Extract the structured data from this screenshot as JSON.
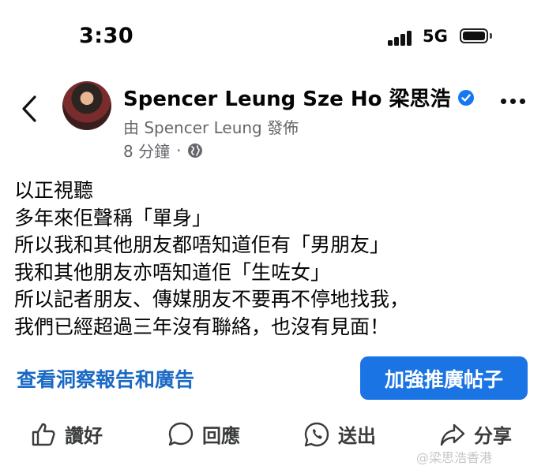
{
  "status_bar": {
    "time": "3:30",
    "network": "5G",
    "signal_icon": "cellular-signal-icon",
    "battery_icon": "battery-icon"
  },
  "post": {
    "author": "Spencer Leung Sze Ho 梁思浩",
    "published_by": "由 Spencer Leung 發佈",
    "time_ago": "8 分鐘",
    "separator": "·",
    "privacy_icon": "globe-icon",
    "verified_icon": "verified-badge-icon",
    "body_lines": [
      "以正視聽",
      "多年來佢聲稱「單身」",
      "所以我和其他朋友都唔知道佢有「男朋友」",
      "我和其他朋友亦唔知道佢「生咗女」",
      "所以記者朋友、傳媒朋友不要再不停地找我，",
      "我們已經超過三年沒有聯絡，也沒有見面！"
    ],
    "insights_link": "查看洞察報告和廣告",
    "boost_button": "加強推廣帖子"
  },
  "actions": {
    "like": "讚好",
    "comment": "回應",
    "send": "送出",
    "share": "分享"
  },
  "watermark": "@梁思浩香港",
  "colors": {
    "accent": "#1b74e4",
    "link": "#1a69c4",
    "secondary_text": "#65676b"
  }
}
